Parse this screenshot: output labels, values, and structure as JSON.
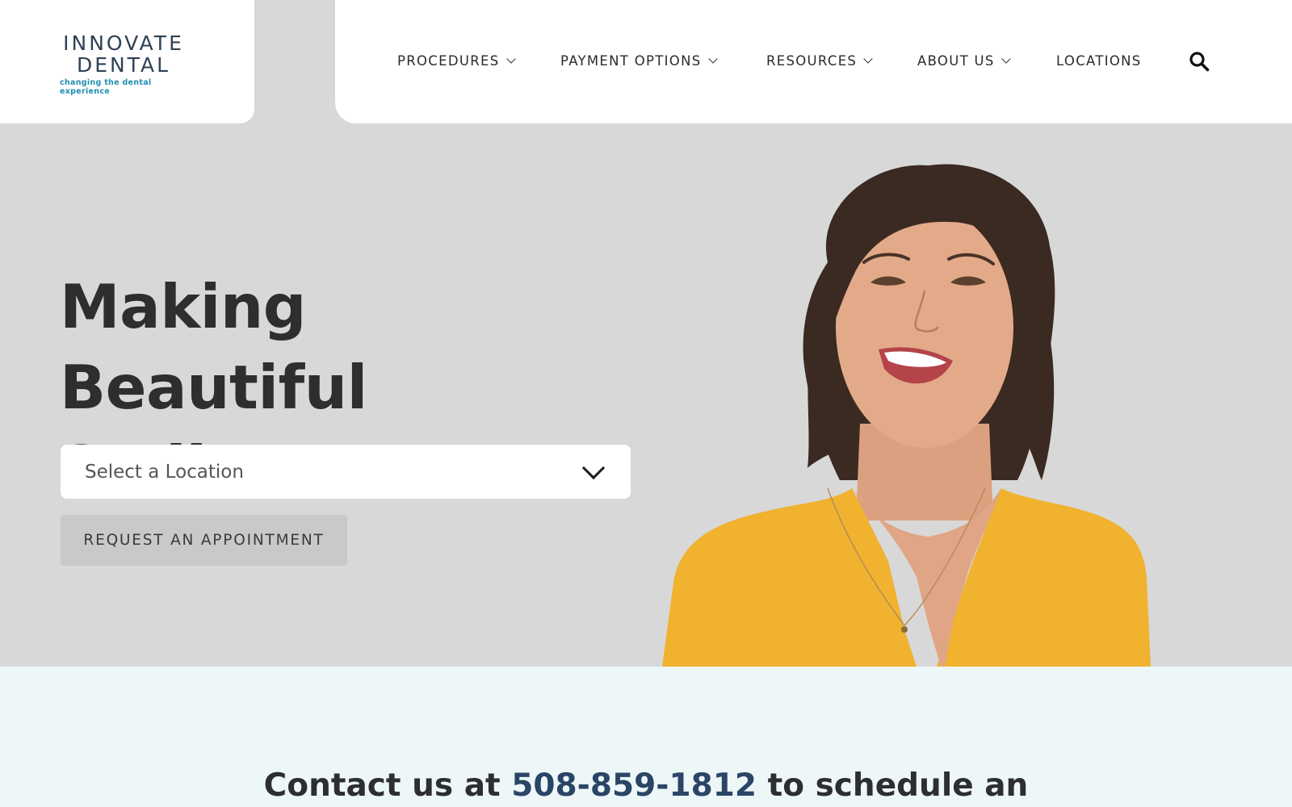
{
  "logo": {
    "line1": "INNOVATE",
    "line2": "DENTAL",
    "tagline": "changing the dental experience"
  },
  "nav": {
    "items": [
      {
        "label": "PROCEDURES",
        "dropdown": true
      },
      {
        "label": "PAYMENT OPTIONS",
        "dropdown": true
      },
      {
        "label": "RESOURCES",
        "dropdown": true
      },
      {
        "label": "ABOUT US",
        "dropdown": true
      },
      {
        "label": "LOCATIONS",
        "dropdown": false
      }
    ],
    "search_icon": "search-icon"
  },
  "hero": {
    "title_line1": "Making Beautiful",
    "title_line2": "Smiles!",
    "location_select": {
      "selected": "Select a Location"
    },
    "appointment_button": "REQUEST AN APPOINTMENT"
  },
  "contact": {
    "prefix": "Contact us at ",
    "phone": "508-859-1812",
    "suffix": " to schedule an"
  },
  "colors": {
    "hero_bg": "#d8d8d8",
    "brand_navy": "#2f4256",
    "brand_teal": "#1f8fb3",
    "contact_bg": "#eef7f8",
    "phone_blue": "#2a4566",
    "shirt_yellow": "#f0b22f"
  }
}
